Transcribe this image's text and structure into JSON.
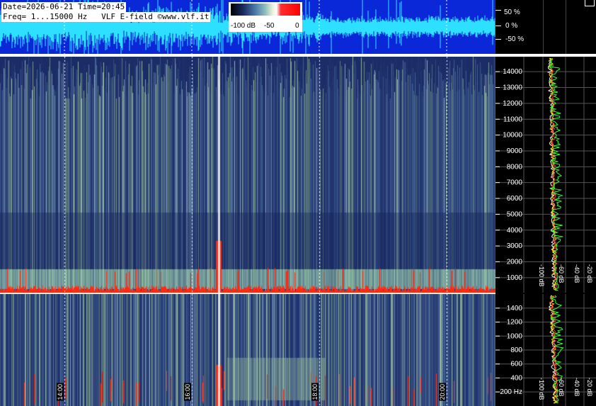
{
  "header": {
    "line1": "Date=2026-06-21 Time=20:45",
    "line2": "Freq= 1...15000 Hz   VLF E-field ©www.vlf.it"
  },
  "colorbar": {
    "labels": [
      "-100 dB",
      "-50",
      "0"
    ]
  },
  "wave_scale": [
    "50 %",
    "0 %",
    "-50 %"
  ],
  "freq_axis_top": [
    "14000",
    "13000",
    "12000",
    "11000",
    "10000",
    "9000",
    "8000",
    "7000",
    "6000",
    "5000",
    "4000",
    "3000",
    "2000",
    "1000"
  ],
  "freq_axis_bottom": [
    "1400",
    "1200",
    "1000",
    "800",
    "600",
    "400",
    "200 Hz"
  ],
  "time_labels": [
    "14:00",
    "16:00",
    "18:00",
    "20:00"
  ],
  "db_labels_top": [
    "-100 dB",
    "-60 dB",
    "-40 dB",
    "-20 dB"
  ],
  "db_labels_bottom": [
    "-100 dB",
    "-60 dB",
    "-40 dB",
    "-20 dB"
  ],
  "colors": {
    "wave_bg": "#0a28d8",
    "wave_trace": "#2ee0ff",
    "spectrum_bg": "#20306a",
    "hot": "#ff2a10"
  }
}
